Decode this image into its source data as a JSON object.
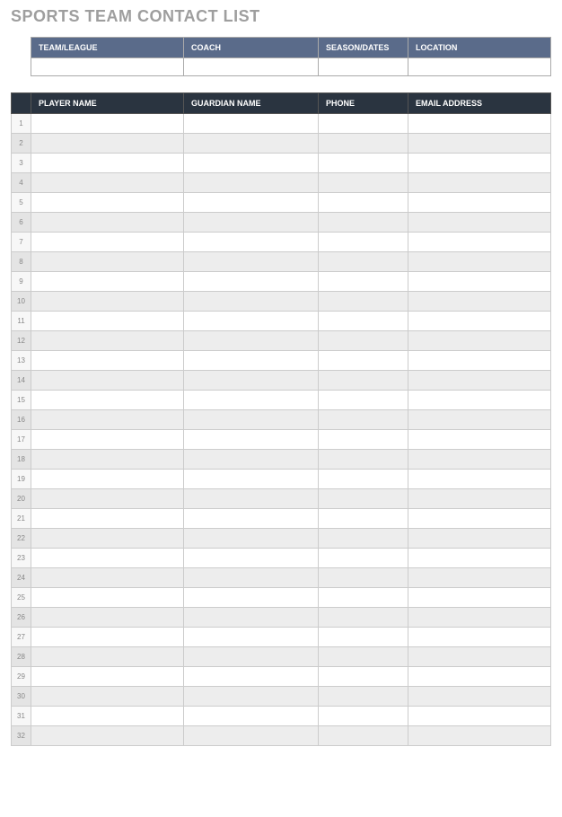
{
  "title": "SPORTS TEAM CONTACT LIST",
  "info": {
    "headers": {
      "team": "TEAM/LEAGUE",
      "coach": "COACH",
      "season": "SEASON/DATES",
      "location": "LOCATION"
    },
    "values": {
      "team": "",
      "coach": "",
      "season": "",
      "location": ""
    }
  },
  "contacts": {
    "headers": {
      "num": "",
      "player": "PLAYER NAME",
      "guardian": "GUARDIAN NAME",
      "phone": "PHONE",
      "email": "EMAIL ADDRESS"
    },
    "rows": [
      {
        "num": "1",
        "player": "",
        "guardian": "",
        "phone": "",
        "email": ""
      },
      {
        "num": "2",
        "player": "",
        "guardian": "",
        "phone": "",
        "email": ""
      },
      {
        "num": "3",
        "player": "",
        "guardian": "",
        "phone": "",
        "email": ""
      },
      {
        "num": "4",
        "player": "",
        "guardian": "",
        "phone": "",
        "email": ""
      },
      {
        "num": "5",
        "player": "",
        "guardian": "",
        "phone": "",
        "email": ""
      },
      {
        "num": "6",
        "player": "",
        "guardian": "",
        "phone": "",
        "email": ""
      },
      {
        "num": "7",
        "player": "",
        "guardian": "",
        "phone": "",
        "email": ""
      },
      {
        "num": "8",
        "player": "",
        "guardian": "",
        "phone": "",
        "email": ""
      },
      {
        "num": "9",
        "player": "",
        "guardian": "",
        "phone": "",
        "email": ""
      },
      {
        "num": "10",
        "player": "",
        "guardian": "",
        "phone": "",
        "email": ""
      },
      {
        "num": "11",
        "player": "",
        "guardian": "",
        "phone": "",
        "email": ""
      },
      {
        "num": "12",
        "player": "",
        "guardian": "",
        "phone": "",
        "email": ""
      },
      {
        "num": "13",
        "player": "",
        "guardian": "",
        "phone": "",
        "email": ""
      },
      {
        "num": "14",
        "player": "",
        "guardian": "",
        "phone": "",
        "email": ""
      },
      {
        "num": "15",
        "player": "",
        "guardian": "",
        "phone": "",
        "email": ""
      },
      {
        "num": "16",
        "player": "",
        "guardian": "",
        "phone": "",
        "email": ""
      },
      {
        "num": "17",
        "player": "",
        "guardian": "",
        "phone": "",
        "email": ""
      },
      {
        "num": "18",
        "player": "",
        "guardian": "",
        "phone": "",
        "email": ""
      },
      {
        "num": "19",
        "player": "",
        "guardian": "",
        "phone": "",
        "email": ""
      },
      {
        "num": "20",
        "player": "",
        "guardian": "",
        "phone": "",
        "email": ""
      },
      {
        "num": "21",
        "player": "",
        "guardian": "",
        "phone": "",
        "email": ""
      },
      {
        "num": "22",
        "player": "",
        "guardian": "",
        "phone": "",
        "email": ""
      },
      {
        "num": "23",
        "player": "",
        "guardian": "",
        "phone": "",
        "email": ""
      },
      {
        "num": "24",
        "player": "",
        "guardian": "",
        "phone": "",
        "email": ""
      },
      {
        "num": "25",
        "player": "",
        "guardian": "",
        "phone": "",
        "email": ""
      },
      {
        "num": "26",
        "player": "",
        "guardian": "",
        "phone": "",
        "email": ""
      },
      {
        "num": "27",
        "player": "",
        "guardian": "",
        "phone": "",
        "email": ""
      },
      {
        "num": "28",
        "player": "",
        "guardian": "",
        "phone": "",
        "email": ""
      },
      {
        "num": "29",
        "player": "",
        "guardian": "",
        "phone": "",
        "email": ""
      },
      {
        "num": "30",
        "player": "",
        "guardian": "",
        "phone": "",
        "email": ""
      },
      {
        "num": "31",
        "player": "",
        "guardian": "",
        "phone": "",
        "email": ""
      },
      {
        "num": "32",
        "player": "",
        "guardian": "",
        "phone": "",
        "email": ""
      }
    ]
  }
}
